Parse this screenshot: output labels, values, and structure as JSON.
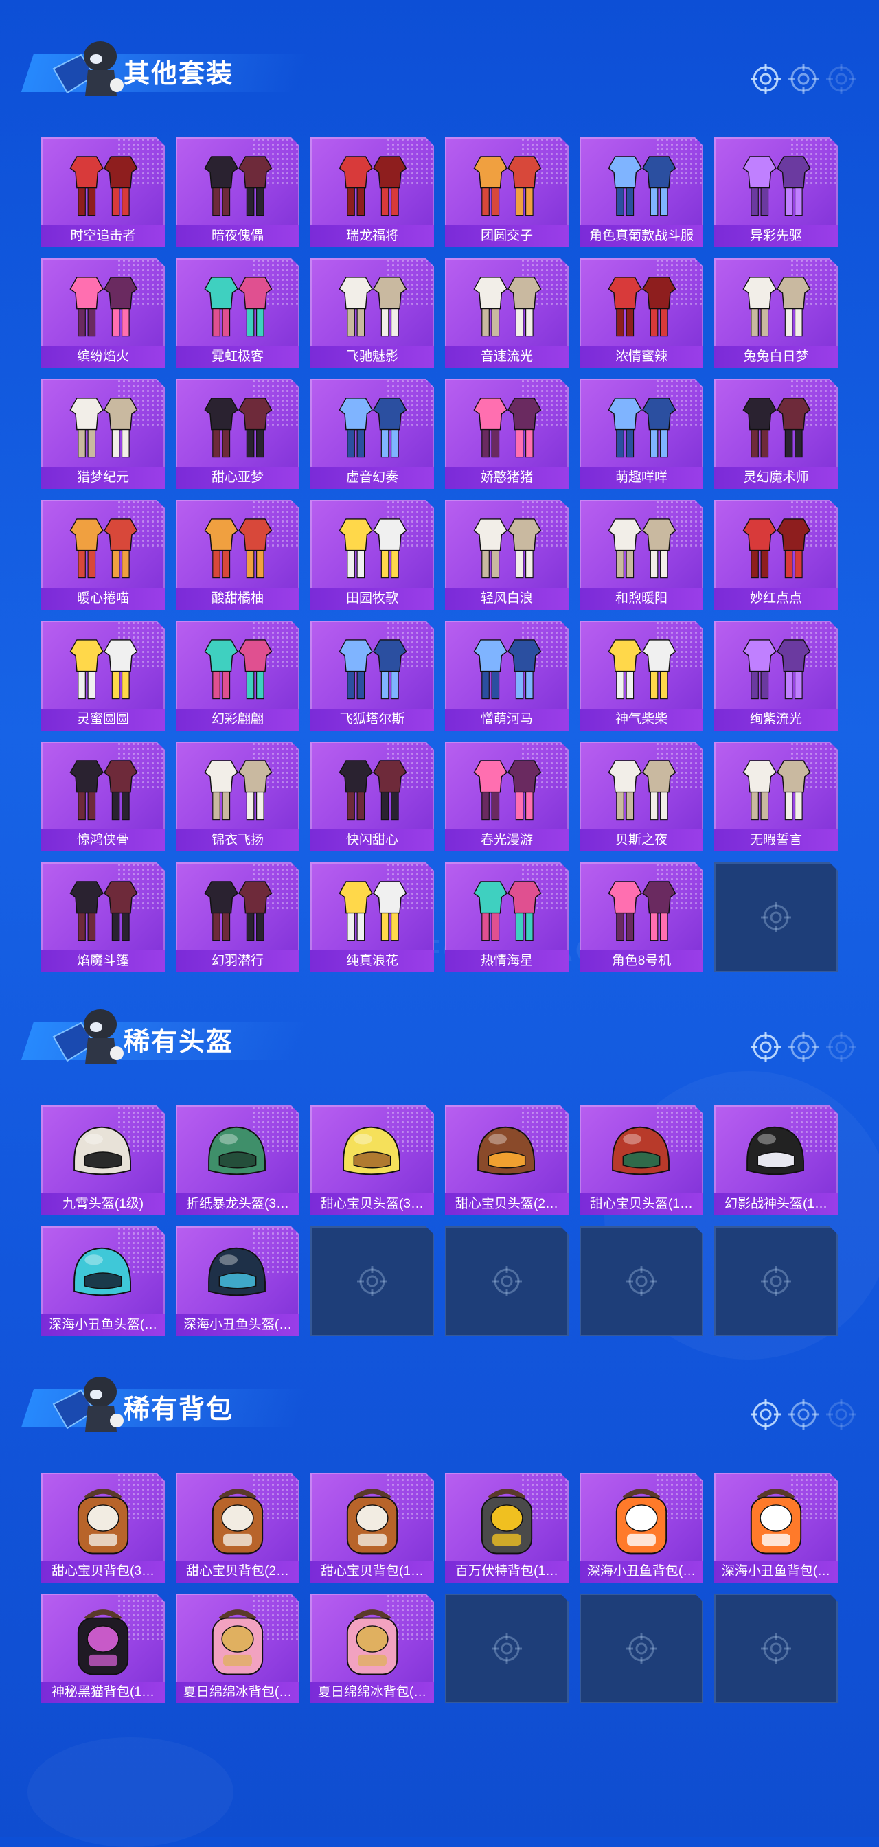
{
  "colors": {
    "background": "#1258dc",
    "card": "#a34ee8",
    "label_bar": "#8431dc",
    "empty_card": "#1e3e79",
    "title_bar": "#2f8cff"
  },
  "watermark": "GAME FOR PEACE",
  "sections": [
    {
      "title": "其他套装",
      "items": [
        {
          "label": "时空追击者",
          "art": "red"
        },
        {
          "label": "暗夜傀儡",
          "art": "dark"
        },
        {
          "label": "瑞龙福将",
          "art": "red"
        },
        {
          "label": "团圆交子",
          "art": "orange"
        },
        {
          "label": "角色真葡款战斗服",
          "art": "blue"
        },
        {
          "label": "异彩先驱",
          "art": "purple"
        },
        {
          "label": "缤纷焰火",
          "art": "pink"
        },
        {
          "label": "霓虹极客",
          "art": "teal"
        },
        {
          "label": "飞驰魅影",
          "art": "white"
        },
        {
          "label": "音速流光",
          "art": "white"
        },
        {
          "label": "浓情蜜辣",
          "art": "red"
        },
        {
          "label": "兔兔白日梦",
          "art": "white"
        },
        {
          "label": "猎梦纪元",
          "art": "white"
        },
        {
          "label": "甜心亚梦",
          "art": "dark"
        },
        {
          "label": "虚音幻奏",
          "art": "blue"
        },
        {
          "label": "娇憨猪猪",
          "art": "pink"
        },
        {
          "label": "萌趣咩咩",
          "art": "blue"
        },
        {
          "label": "灵幻魔术师",
          "art": "dark"
        },
        {
          "label": "暖心捲喵",
          "art": "orange"
        },
        {
          "label": "酸甜橘柚",
          "art": "orange"
        },
        {
          "label": "田园牧歌",
          "art": "yellow"
        },
        {
          "label": "轻风白浪",
          "art": "white"
        },
        {
          "label": "和煦暖阳",
          "art": "white"
        },
        {
          "label": "妙红点点",
          "art": "red"
        },
        {
          "label": "灵蜜圆圆",
          "art": "yellow"
        },
        {
          "label": "幻彩翩翩",
          "art": "teal"
        },
        {
          "label": "飞狐塔尔斯",
          "art": "blue"
        },
        {
          "label": "憎萌河马",
          "art": "blue"
        },
        {
          "label": "神气柴柴",
          "art": "yellow"
        },
        {
          "label": "绚紫流光",
          "art": "purple"
        },
        {
          "label": "惊鸿侠骨",
          "art": "dark"
        },
        {
          "label": "锦衣飞扬",
          "art": "white"
        },
        {
          "label": "快闪甜心",
          "art": "dark"
        },
        {
          "label": "春光漫游",
          "art": "pink"
        },
        {
          "label": "贝斯之夜",
          "art": "white"
        },
        {
          "label": "无暇誓言",
          "art": "white"
        },
        {
          "label": "焰魔斗篷",
          "art": "dark"
        },
        {
          "label": "幻羽潜行",
          "art": "dark"
        },
        {
          "label": "纯真浪花",
          "art": "yellow"
        },
        {
          "label": "热情海星",
          "art": "teal"
        },
        {
          "label": "角色8号机",
          "art": "pink"
        },
        null
      ]
    },
    {
      "title": "稀有头盔",
      "items": [
        {
          "label": "九霄头盔(1级)",
          "art": "helmet-white"
        },
        {
          "label": "折纸暴龙头盔(3…",
          "art": "helmet-green"
        },
        {
          "label": "甜心宝贝头盔(3…",
          "art": "helmet-yellow"
        },
        {
          "label": "甜心宝贝头盔(2…",
          "art": "helmet-brown"
        },
        {
          "label": "甜心宝贝头盔(1…",
          "art": "helmet-red"
        },
        {
          "label": "幻影战神头盔(1…",
          "art": "helmet-black"
        },
        {
          "label": "深海小丑鱼头盔(…",
          "art": "helmet-cyan"
        },
        {
          "label": "深海小丑鱼头盔(…",
          "art": "helmet-navy"
        },
        null,
        null,
        null,
        null
      ]
    },
    {
      "title": "稀有背包",
      "items": [
        {
          "label": "甜心宝贝背包(3…",
          "art": "bag-cake"
        },
        {
          "label": "甜心宝贝背包(2…",
          "art": "bag-cake"
        },
        {
          "label": "甜心宝贝背包(1…",
          "art": "bag-cake"
        },
        {
          "label": "百万伏特背包(1…",
          "art": "bag-gray"
        },
        {
          "label": "深海小丑鱼背包(…",
          "art": "bag-fish"
        },
        {
          "label": "深海小丑鱼背包(…",
          "art": "bag-fish"
        },
        {
          "label": "神秘黑猫背包(1…",
          "art": "bag-cat"
        },
        {
          "label": "夏日绵绵冰背包(…",
          "art": "bag-ice"
        },
        {
          "label": "夏日绵绵冰背包(…",
          "art": "bag-ice"
        },
        null,
        null,
        null
      ]
    }
  ]
}
